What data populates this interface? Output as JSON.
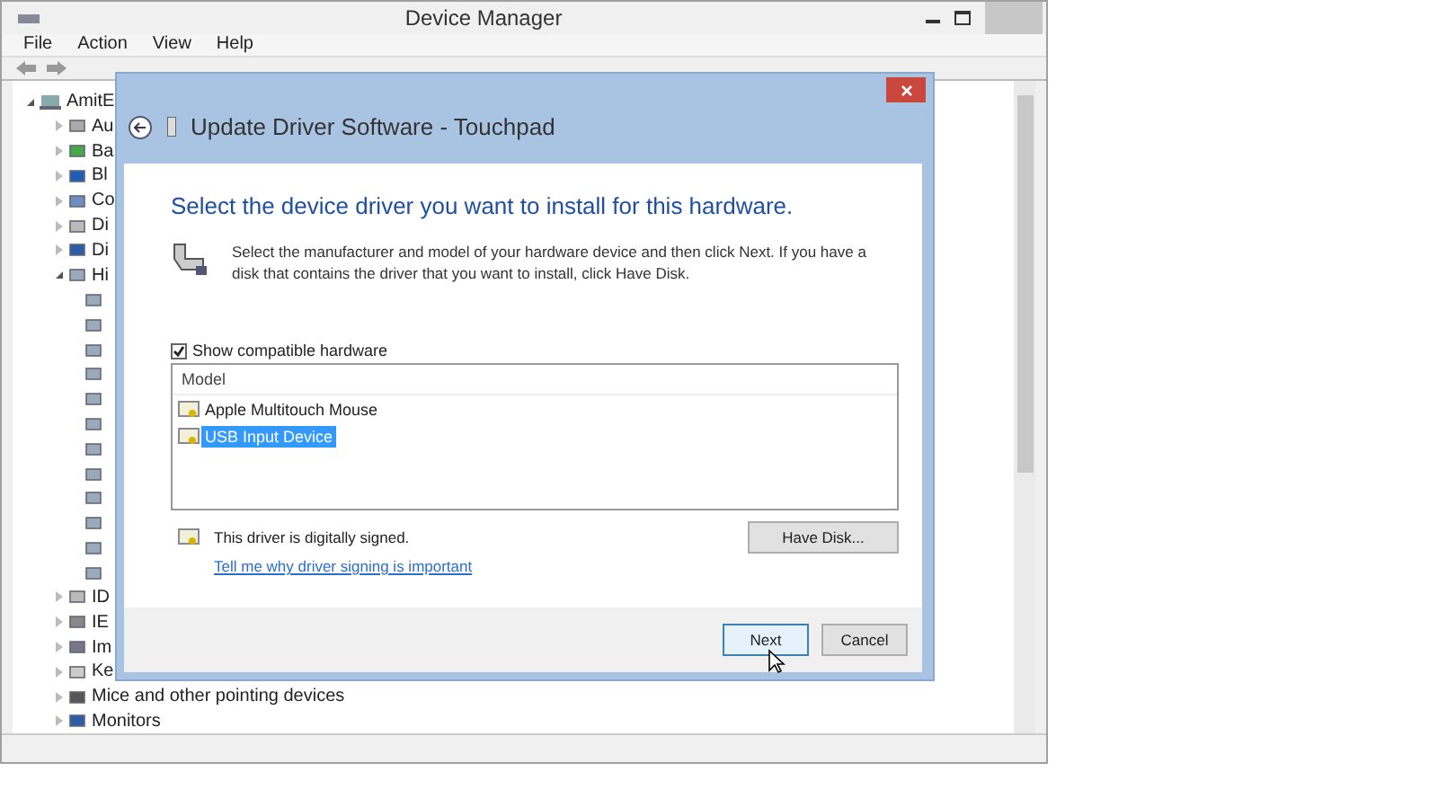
{
  "window": {
    "title": "Device Manager"
  },
  "menu": [
    "File",
    "Action",
    "View",
    "Help"
  ],
  "tree": [
    {
      "label": "AmitE",
      "expanded": true,
      "children": [
        {
          "label": "Au",
          "expanded": false,
          "kind": "audio"
        },
        {
          "label": "Ba",
          "expanded": false,
          "kind": "battery"
        },
        {
          "label": "Bl",
          "expanded": false,
          "kind": "bluetooth"
        },
        {
          "label": "Co",
          "expanded": false,
          "kind": "computer"
        },
        {
          "label": "Di",
          "expanded": false,
          "kind": "drive"
        },
        {
          "label": "Di",
          "expanded": false,
          "kind": "display"
        },
        {
          "label": "Hi",
          "expanded": true,
          "kind": "hid",
          "children": [
            {
              "kind": "hid"
            },
            {
              "kind": "hid"
            },
            {
              "kind": "hid"
            },
            {
              "kind": "hid"
            },
            {
              "kind": "hid"
            },
            {
              "kind": "hid"
            },
            {
              "kind": "hid"
            },
            {
              "kind": "hid"
            },
            {
              "kind": "hid"
            },
            {
              "kind": "hid"
            },
            {
              "kind": "hid"
            },
            {
              "kind": "hid"
            }
          ]
        },
        {
          "label": "ID",
          "expanded": false,
          "kind": "drive"
        },
        {
          "label": "IE",
          "expanded": false,
          "kind": "printer"
        },
        {
          "label": "Im",
          "expanded": false,
          "kind": "camera"
        },
        {
          "label": "Ke",
          "expanded": false,
          "kind": "keyboard"
        },
        {
          "label": "Mice and other pointing devices",
          "expanded": false,
          "kind": "mouse"
        },
        {
          "label": "Monitors",
          "expanded": false,
          "kind": "display"
        }
      ]
    }
  ],
  "dialog": {
    "title": "Update Driver Software - Touchpad",
    "heading": "Select the device driver you want to install for this hardware.",
    "description": "Select the manufacturer and model of your hardware device and then click Next. If you have a disk that contains the driver that you want to install, click Have Disk.",
    "show_compatible": {
      "label": "Show compatible hardware",
      "checked": true
    },
    "model_list": {
      "header": "Model",
      "items": [
        {
          "label": "Apple Multitouch Mouse",
          "selected": false
        },
        {
          "label": "USB Input Device",
          "selected": true
        }
      ]
    },
    "signed_text": "This driver is digitally signed.",
    "link": "Tell me why driver signing is important",
    "have_disk": "Have Disk...",
    "buttons": [
      {
        "label": "Next",
        "kind": "default"
      },
      {
        "label": "Cancel",
        "kind": "normal"
      }
    ]
  }
}
